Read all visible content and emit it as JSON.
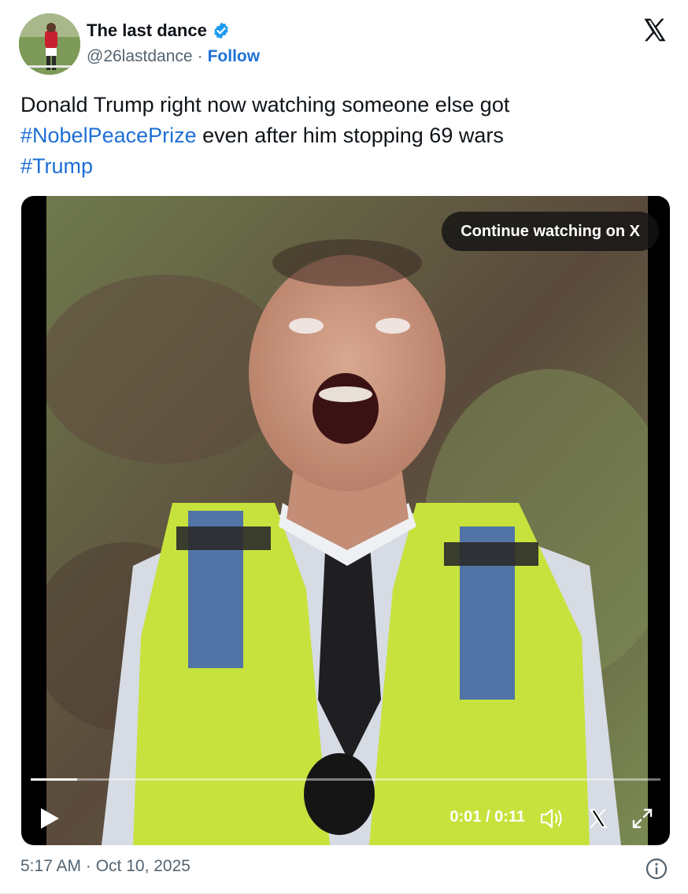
{
  "author": {
    "name": "The last dance",
    "handle": "@26lastdance",
    "separator": "·",
    "follow_label": "Follow",
    "verified_icon": "verified-badge-icon",
    "verified_color": "#1d9bf0"
  },
  "platform_icon": "x-logo-icon",
  "tweet": {
    "line1": "Donald Trump right now watching someone else got",
    "hashtag1": "#NobelPeacePrize",
    "line2_rest": " even after him stopping 69 wars",
    "hashtag2": "#Trump",
    "hashtag_color": "#1d6fd6"
  },
  "video": {
    "overlay_label": "Continue watching on X",
    "time_display": "0:01 / 0:11",
    "progress_fraction": 0.074,
    "play_icon": "play-icon",
    "volume_icon": "volume-icon",
    "x_icon": "x-logo-icon",
    "fullscreen_icon": "fullscreen-icon"
  },
  "footer": {
    "timestamp": "5:17 AM · Oct 10, 2025",
    "info_icon": "info-icon"
  }
}
